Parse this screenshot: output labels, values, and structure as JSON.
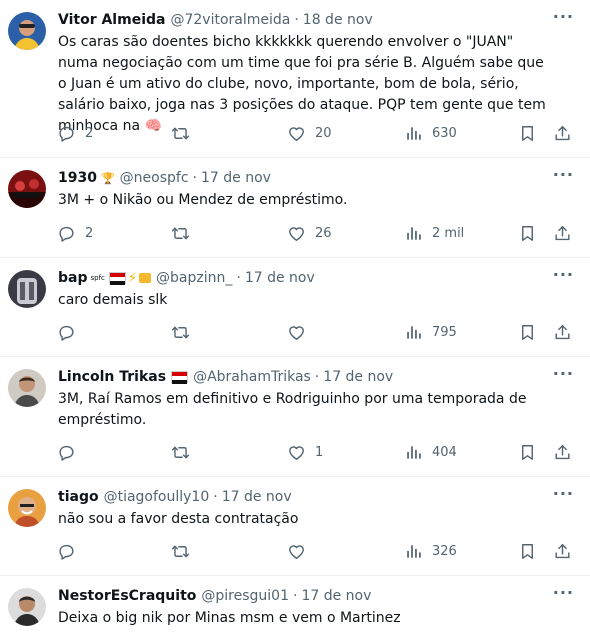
{
  "tweets": [
    {
      "name": "Vitor Almeida",
      "badges": "",
      "handle": "@72vitoralmeida",
      "date": "18 de nov",
      "text": "Os caras são doentes bicho kkkkkkk querendo envolver o \"JUAN\" numa negociação com um time que foi pra série B. Alguém sabe que o Juan é um ativo do clube, novo, importante, bom de bola, sério, salário baixo, joga nas 3 posições do ataque. PQP tem gente que tem minhoca na 🧠",
      "replies": "2",
      "retweets": "",
      "likes": "20",
      "views": "630"
    },
    {
      "name": "1930",
      "badges": "🏆",
      "handle": "@neospfc",
      "date": "17 de nov",
      "text": "3M + o Nikão ou Mendez de empréstimo.",
      "replies": "2",
      "retweets": "",
      "likes": "26",
      "views": "2 mil"
    },
    {
      "name": "bap",
      "badges": "spfc",
      "handle": "@bapzinn_",
      "date": "17 de nov",
      "text": "caro demais slk",
      "replies": "",
      "retweets": "",
      "likes": "",
      "views": "795"
    },
    {
      "name": "Lincoln Trikas",
      "badges": "",
      "handle": "@AbrahamTrikas",
      "date": "17 de nov",
      "text": "3M, Raí Ramos em definitivo e Rodriguinho por uma temporada de empréstimo.",
      "replies": "",
      "retweets": "",
      "likes": "1",
      "views": "404"
    },
    {
      "name": "tiago",
      "badges": "",
      "handle": "@tiagofoully10",
      "date": "17 de nov",
      "text": "não sou a favor desta contratação",
      "replies": "",
      "retweets": "",
      "likes": "",
      "views": "326"
    },
    {
      "name": "NestorEsCraquito",
      "badges": "",
      "handle": "@piresgui01",
      "date": "17 de nov",
      "text": "Deixa o big nik por Minas msm e vem o Martinez",
      "replies": "",
      "retweets": "",
      "likes": "",
      "views": ""
    }
  ],
  "ui": {
    "separator": "·",
    "more": "···"
  },
  "icons": {
    "reply": "reply-icon",
    "retweet": "retweet-icon",
    "like": "like-icon",
    "views": "views-icon",
    "bookmark": "bookmark-icon",
    "share": "share-icon",
    "more": "more-icon"
  },
  "colors": {
    "text": "#0f1419",
    "muted": "#536471",
    "divider": "#eff3f4"
  }
}
